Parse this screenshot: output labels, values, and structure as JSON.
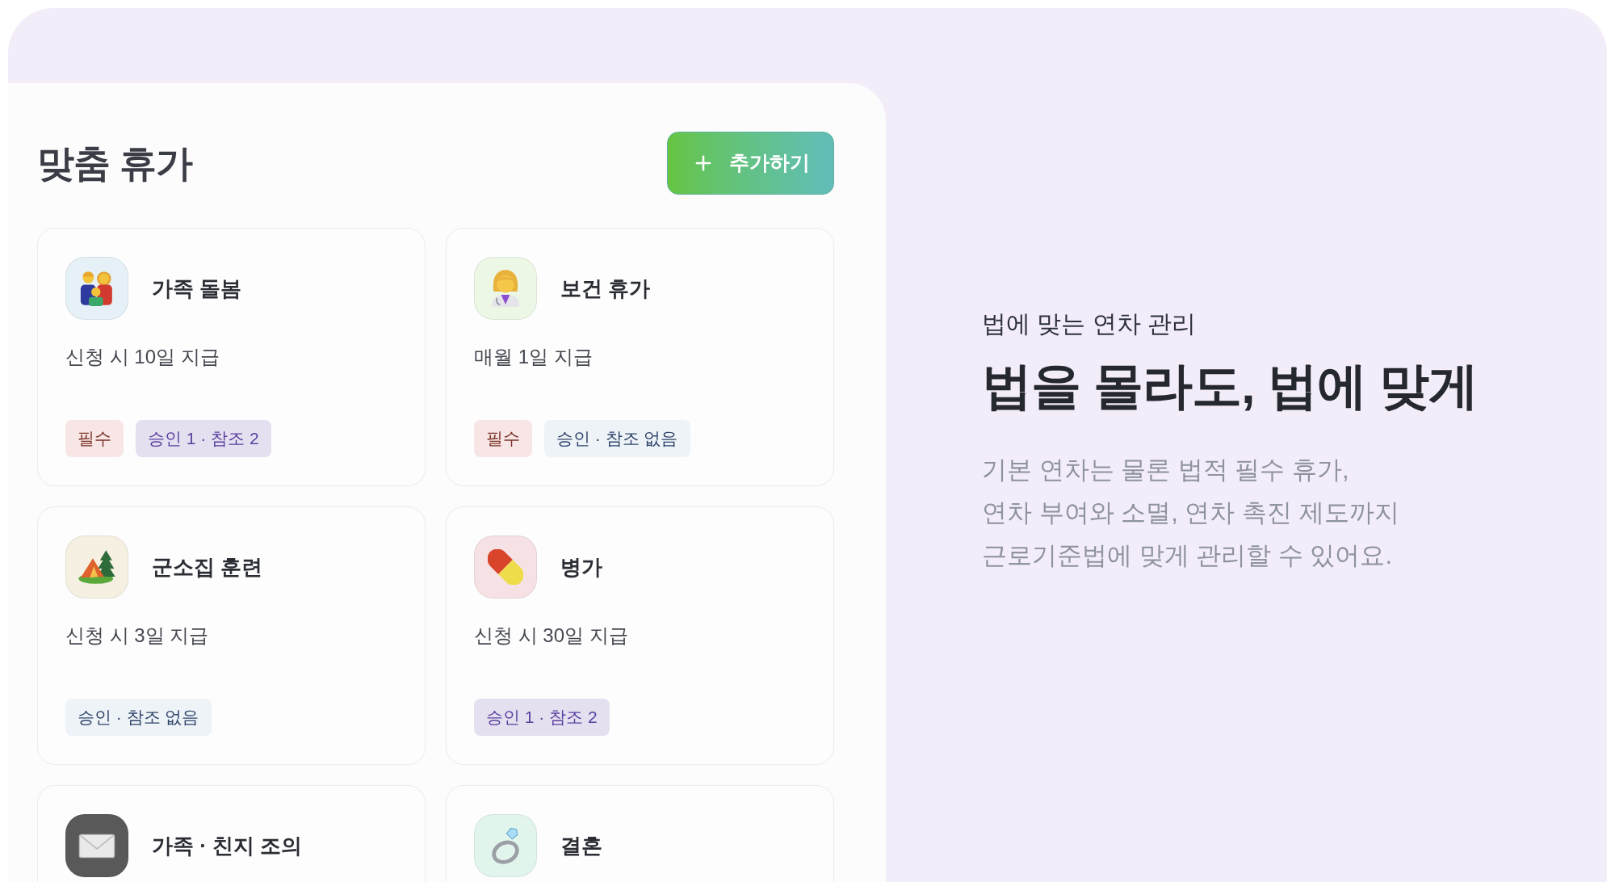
{
  "panel": {
    "title": "맞춤 휴가",
    "add_button": {
      "label": "추가하기"
    },
    "cards": [
      {
        "kind": "family",
        "color": "#e6f1f7",
        "title": "가족 돌봄",
        "grant": "신청 시 10일 지급",
        "tags": [
          {
            "kind": "required",
            "label": "필수"
          },
          {
            "kind": "approval",
            "label": "승인 1 · 참조 2"
          }
        ]
      },
      {
        "kind": "health",
        "color": "#edf7e6",
        "title": "보건 휴가",
        "grant": "매월 1일 지급",
        "tags": [
          {
            "kind": "required",
            "label": "필수"
          },
          {
            "kind": "no_approval",
            "label": "승인 · 참조 없음"
          }
        ]
      },
      {
        "kind": "training",
        "color": "#f6f0e3",
        "title": "군소집 훈련",
        "grant": "신청 시 3일 지급",
        "tags": [
          {
            "kind": "no_approval",
            "label": "승인 · 참조 없음"
          }
        ]
      },
      {
        "kind": "sick",
        "color": "#f6e2e5",
        "title": "병가",
        "grant": "신청 시 30일 지급",
        "tags": [
          {
            "kind": "approval",
            "label": "승인 1 · 참조 2"
          }
        ]
      },
      {
        "kind": "condolence",
        "color": "#595959",
        "title": "가족 · 친지 조의"
      },
      {
        "kind": "wedding",
        "color": "#e2f5ec",
        "title": "결혼"
      }
    ]
  },
  "promo": {
    "eyebrow": "법에 맞는 연차 관리",
    "headline": "법을 몰라도, 법에 맞게",
    "body_lines": [
      "기본 연차는 물론 법적 필수 휴가,",
      "연차 부여와 소멸, 연차 촉진 제도까지",
      "근로기준법에 맞게 관리할 수 있어요."
    ]
  }
}
